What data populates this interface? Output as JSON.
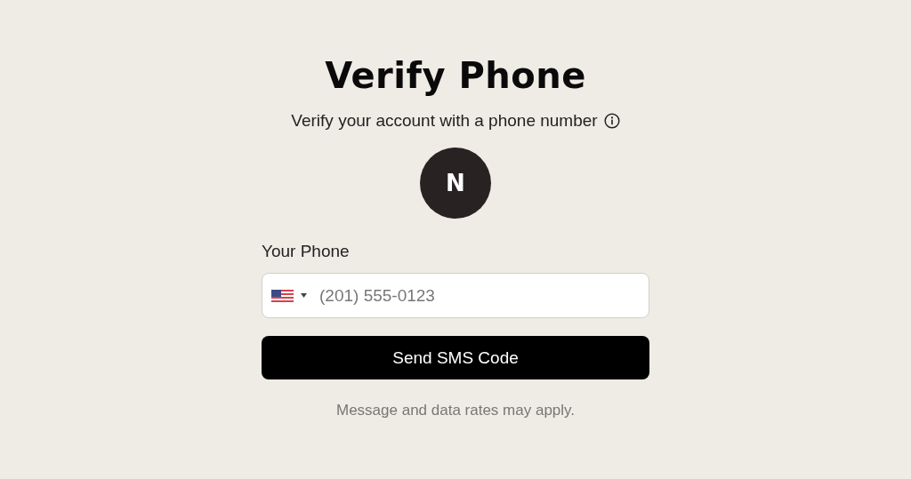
{
  "title": "Verify Phone",
  "subtitle": "Verify your account with a phone number",
  "avatar": {
    "initial": "N"
  },
  "phone_field": {
    "label": "Your Phone",
    "placeholder": "(201) 555-0123"
  },
  "submit_button": {
    "label": "Send SMS Code"
  },
  "footnote": "Message and data rates may apply."
}
